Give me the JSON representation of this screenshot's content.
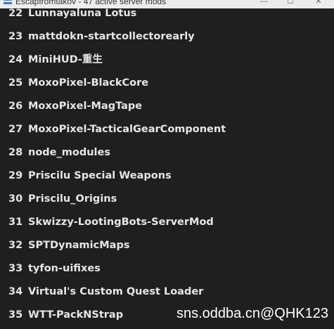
{
  "window": {
    "title": "Escapfromtakov - 47 active server mods",
    "min_glyph": "—",
    "max_glyph": "☐",
    "close_glyph": "✕"
  },
  "mods": [
    {
      "num": "22",
      "name": "Lunnayaluna Lotus"
    },
    {
      "num": "23",
      "name": "mattdokn-startcollectorearly"
    },
    {
      "num": "24",
      "name": "MiniHUD-重生"
    },
    {
      "num": "25",
      "name": "MoxoPixel-BlackCore"
    },
    {
      "num": "26",
      "name": "MoxoPixel-MagTape"
    },
    {
      "num": "27",
      "name": "MoxoPixel-TacticalGearComponent"
    },
    {
      "num": "28",
      "name": "node_modules"
    },
    {
      "num": "29",
      "name": "Priscilu Special Weapons"
    },
    {
      "num": "30",
      "name": "Priscilu_Origins"
    },
    {
      "num": "31",
      "name": "Skwizzy-LootingBots-ServerMod"
    },
    {
      "num": "32",
      "name": "SPTDynamicMaps"
    },
    {
      "num": "33",
      "name": "tyfon-uifixes"
    },
    {
      "num": "34",
      "name": "Virtual's Custom Quest Loader"
    },
    {
      "num": "35",
      "name": "WTT-PackNStrap"
    }
  ],
  "watermark": "sns.oddba.cn@QHK123"
}
